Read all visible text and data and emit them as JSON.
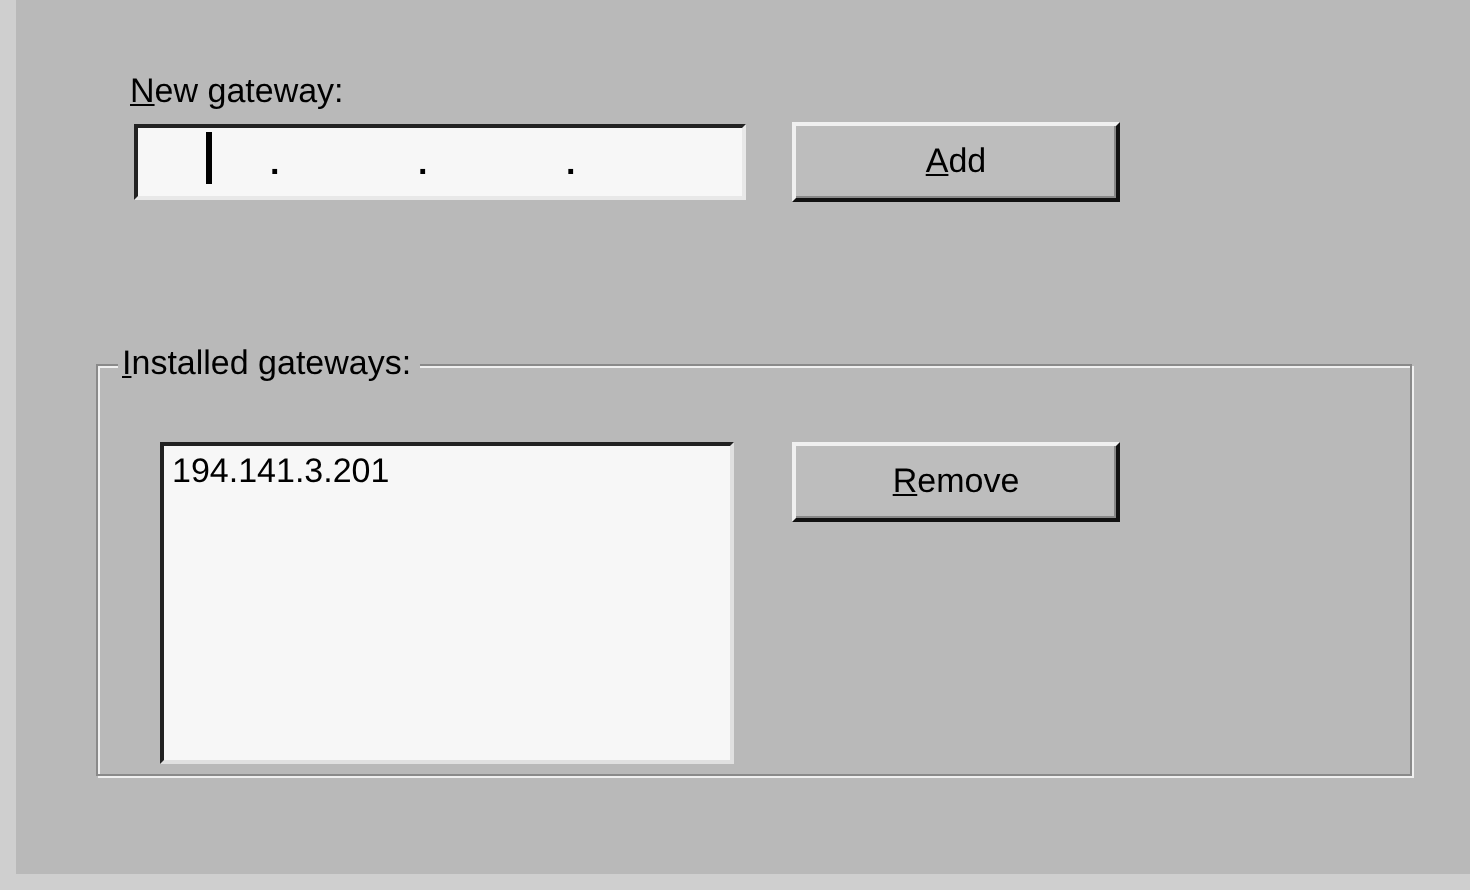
{
  "new_gateway": {
    "label": "New gateway:",
    "label_access_key_first": true,
    "field": {
      "focused": true,
      "separators": [
        ".",
        ".",
        "."
      ]
    },
    "button": {
      "label": "Add",
      "access_key_first": true
    }
  },
  "installed_gateways": {
    "label": "Installed gateways:",
    "label_access_key_first": true,
    "items": [
      {
        "text": "194.141.3.201",
        "selected": false
      }
    ],
    "button": {
      "label": "Remove",
      "access_key_first": true
    }
  }
}
